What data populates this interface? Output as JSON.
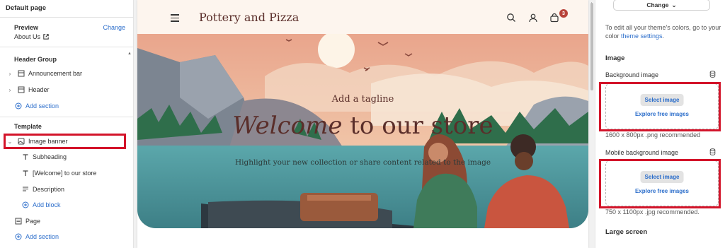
{
  "left": {
    "page_title": "Default page",
    "preview": {
      "label": "Preview",
      "change": "Change",
      "value": "About Us"
    },
    "header_group": {
      "title": "Header Group",
      "items": [
        {
          "label": "Announcement bar",
          "icon": "layout-icon"
        },
        {
          "label": "Header",
          "icon": "layout-icon"
        }
      ],
      "add_section": "Add section"
    },
    "template": {
      "title": "Template",
      "banner": {
        "label": "Image banner",
        "icon": "image-icon"
      },
      "children": [
        {
          "label": "Subheading",
          "icon": "text-icon"
        },
        {
          "label": "[Welcome] to our store",
          "icon": "text-icon"
        },
        {
          "label": "Description",
          "icon": "paragraph-icon"
        }
      ],
      "add_block": "Add block",
      "page": {
        "label": "Page",
        "icon": "page-icon"
      },
      "add_section": "Add section"
    }
  },
  "store": {
    "name": "Pottery and Pizza",
    "cart_count": "3",
    "tagline": "Add a tagline",
    "heading_italic": "Welcome",
    "heading_rest": " to our store",
    "description": "Highlight your new collection or share content related to the image"
  },
  "right": {
    "change_button": "Change",
    "info_prefix": "To edit all your theme's colors, go to your color ",
    "info_link": "theme settings",
    "info_suffix": ".",
    "image_section": "Image",
    "background": {
      "label": "Background image",
      "select": "Select image",
      "explore": "Explore free images",
      "hint": "1600 x 800px .png recommended"
    },
    "mobile": {
      "label": "Mobile background image",
      "select": "Select image",
      "explore": "Explore free images",
      "hint": "750 x 1100px .jpg recommended."
    },
    "large_screen": "Large screen"
  },
  "colors": {
    "accent": "#2c6ecb",
    "highlight": "#d3142a",
    "brand_text": "#5a2e2a",
    "badge": "#b8433a"
  }
}
